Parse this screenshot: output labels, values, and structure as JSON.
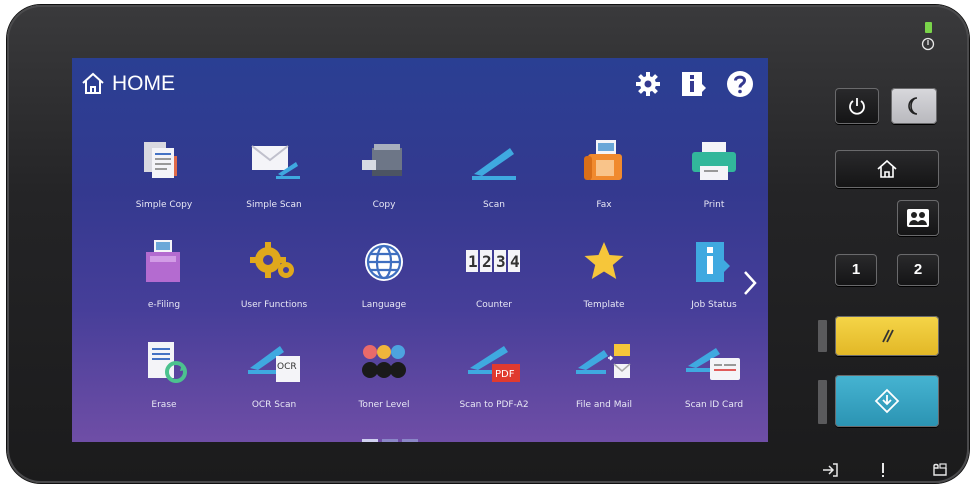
{
  "screen": {
    "title": "HOME",
    "top_icons": [
      "gear-icon",
      "info-icon",
      "help-icon"
    ],
    "tiles": [
      {
        "label": "Simple Copy",
        "icon": "simple-copy-icon"
      },
      {
        "label": "Simple Scan",
        "icon": "simple-scan-icon"
      },
      {
        "label": "Copy",
        "icon": "copy-icon"
      },
      {
        "label": "Scan",
        "icon": "scan-icon"
      },
      {
        "label": "Fax",
        "icon": "fax-icon"
      },
      {
        "label": "Print",
        "icon": "print-icon"
      },
      {
        "label": "e-Filing",
        "icon": "e-filing-icon"
      },
      {
        "label": "User Functions",
        "icon": "user-functions-icon"
      },
      {
        "label": "Language",
        "icon": "language-icon"
      },
      {
        "label": "Counter",
        "icon": "counter-icon"
      },
      {
        "label": "Template",
        "icon": "template-icon"
      },
      {
        "label": "Job Status",
        "icon": "job-status-icon"
      },
      {
        "label": "Erase",
        "icon": "erase-icon"
      },
      {
        "label": "OCR Scan",
        "icon": "ocr-scan-icon"
      },
      {
        "label": "Toner Level",
        "icon": "toner-level-icon"
      },
      {
        "label": "Scan to PDF-A2",
        "icon": "scan-to-pdf-icon"
      },
      {
        "label": "File and Mail",
        "icon": "file-and-mail-icon"
      },
      {
        "label": "Scan ID Card",
        "icon": "scan-id-card-icon"
      }
    ],
    "counter_digits": "1234",
    "ocr_text": "OCR",
    "pdf_text": "PDF",
    "pager": {
      "pages": 3,
      "current": 1
    }
  },
  "hardware": {
    "key_1": "1",
    "key_2": "2",
    "accent_yellow": "#f2cf3a",
    "accent_teal": "#39a7c5",
    "led_color": "#7ad44a"
  }
}
